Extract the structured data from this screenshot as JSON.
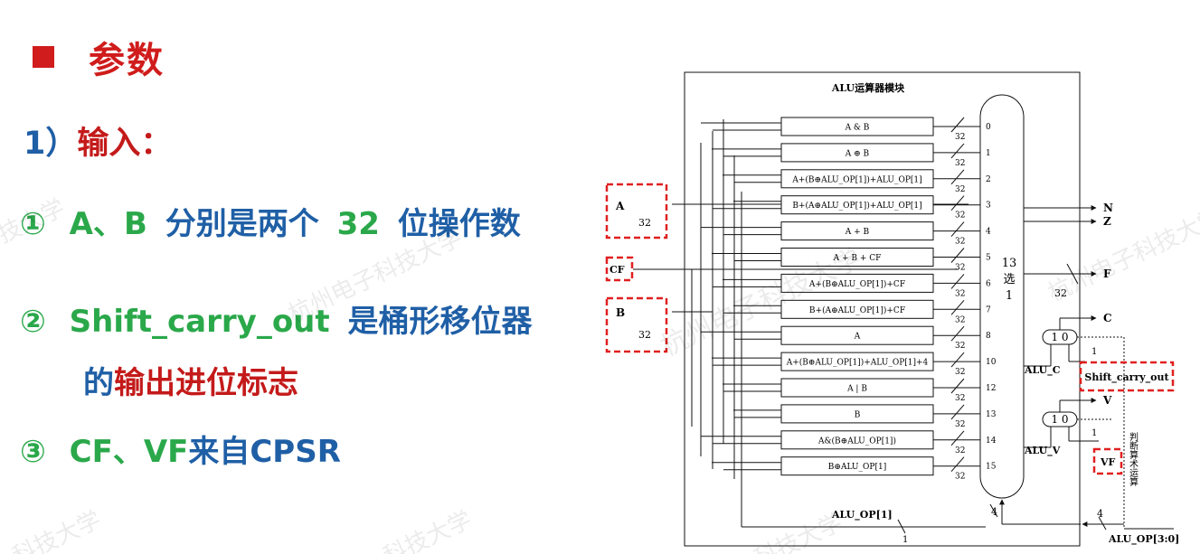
{
  "slide": {
    "title": "参数",
    "input_heading_num": "1）",
    "input_heading_text": "输入：",
    "item1_num": "①",
    "item1_a": "A、B",
    "item1_b": "分别是两个",
    "item1_c": "32",
    "item1_d": "位操作数",
    "item2_num": "②",
    "item2_a": "Shift_carry_out",
    "item2_b": "是桶形移位器",
    "item2_c": "的",
    "item2_d": "输出进位标志",
    "item3_num": "③",
    "item3_a": "CF、VF",
    "item3_b": "来自CPSR",
    "watermark": "杭州电子科技大学",
    "watermark_short": "科技大学"
  },
  "colors": {
    "title_red": "#d01c1c",
    "text_blue": "#1f5fa6",
    "text_red": "#c41a1a",
    "text_green": "#2aa84a",
    "highlight_dashed": "#e02020"
  },
  "diagram": {
    "module_title": "ALU运算器模块",
    "inputs": {
      "a": "A",
      "cf": "CF",
      "b": "B",
      "width": "32"
    },
    "ops": [
      "A & B",
      "A ⊕ B",
      "A+(B⊕ALU_OP[1])+ALU_OP[1]",
      "B+(A⊕ALU_OP[1])+ALU_OP[1]",
      "A + B",
      "A + B + CF",
      "A+(B⊕ALU_OP[1])+CF",
      "B+(A⊕ALU_OP[1])+CF",
      "A",
      "A+(B⊕ALU_OP[1])+ALU_OP[1]+4",
      "A | B",
      "B",
      "A&(B⊕ALU_OP[1])",
      "B⊕ALU_OP[1]"
    ],
    "mux_indices": [
      "0",
      "1",
      "2",
      "3",
      "4",
      "5",
      "6",
      "7",
      "8",
      "10",
      "12",
      "13",
      "14",
      "15"
    ],
    "bus_width": "32",
    "mux_label": [
      "13",
      "选",
      "1"
    ],
    "outputs": {
      "n": "N",
      "z": "Z",
      "f": "F",
      "f_width": "32",
      "c": "C",
      "v": "V"
    },
    "mux2_label": "1  0",
    "alu_c": "ALU_C",
    "alu_v": "ALU_V",
    "shift_carry_out": "Shift_carry_out",
    "vf": "VF",
    "one": "1",
    "four": "4",
    "alu_op1": "ALU_OP[1]",
    "alu_op": "ALU_OP[3:0]",
    "vertical_note": "判断算术运算"
  }
}
